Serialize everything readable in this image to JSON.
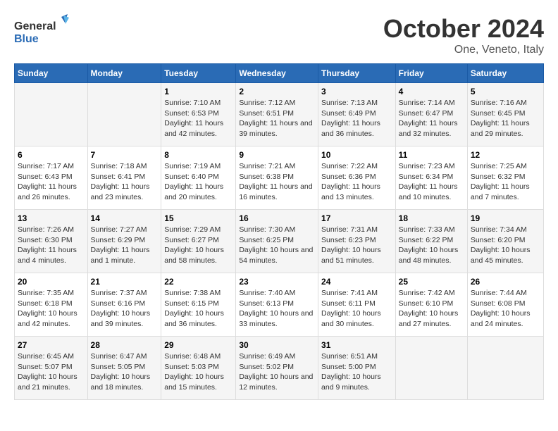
{
  "header": {
    "logo_line1": "General",
    "logo_line2": "Blue",
    "month": "October 2024",
    "location": "One, Veneto, Italy"
  },
  "days_of_week": [
    "Sunday",
    "Monday",
    "Tuesday",
    "Wednesday",
    "Thursday",
    "Friday",
    "Saturday"
  ],
  "weeks": [
    [
      {
        "day": "",
        "info": ""
      },
      {
        "day": "",
        "info": ""
      },
      {
        "day": "1",
        "info": "Sunrise: 7:10 AM\nSunset: 6:53 PM\nDaylight: 11 hours and 42 minutes."
      },
      {
        "day": "2",
        "info": "Sunrise: 7:12 AM\nSunset: 6:51 PM\nDaylight: 11 hours and 39 minutes."
      },
      {
        "day": "3",
        "info": "Sunrise: 7:13 AM\nSunset: 6:49 PM\nDaylight: 11 hours and 36 minutes."
      },
      {
        "day": "4",
        "info": "Sunrise: 7:14 AM\nSunset: 6:47 PM\nDaylight: 11 hours and 32 minutes."
      },
      {
        "day": "5",
        "info": "Sunrise: 7:16 AM\nSunset: 6:45 PM\nDaylight: 11 hours and 29 minutes."
      }
    ],
    [
      {
        "day": "6",
        "info": "Sunrise: 7:17 AM\nSunset: 6:43 PM\nDaylight: 11 hours and 26 minutes."
      },
      {
        "day": "7",
        "info": "Sunrise: 7:18 AM\nSunset: 6:41 PM\nDaylight: 11 hours and 23 minutes."
      },
      {
        "day": "8",
        "info": "Sunrise: 7:19 AM\nSunset: 6:40 PM\nDaylight: 11 hours and 20 minutes."
      },
      {
        "day": "9",
        "info": "Sunrise: 7:21 AM\nSunset: 6:38 PM\nDaylight: 11 hours and 16 minutes."
      },
      {
        "day": "10",
        "info": "Sunrise: 7:22 AM\nSunset: 6:36 PM\nDaylight: 11 hours and 13 minutes."
      },
      {
        "day": "11",
        "info": "Sunrise: 7:23 AM\nSunset: 6:34 PM\nDaylight: 11 hours and 10 minutes."
      },
      {
        "day": "12",
        "info": "Sunrise: 7:25 AM\nSunset: 6:32 PM\nDaylight: 11 hours and 7 minutes."
      }
    ],
    [
      {
        "day": "13",
        "info": "Sunrise: 7:26 AM\nSunset: 6:30 PM\nDaylight: 11 hours and 4 minutes."
      },
      {
        "day": "14",
        "info": "Sunrise: 7:27 AM\nSunset: 6:29 PM\nDaylight: 11 hours and 1 minute."
      },
      {
        "day": "15",
        "info": "Sunrise: 7:29 AM\nSunset: 6:27 PM\nDaylight: 10 hours and 58 minutes."
      },
      {
        "day": "16",
        "info": "Sunrise: 7:30 AM\nSunset: 6:25 PM\nDaylight: 10 hours and 54 minutes."
      },
      {
        "day": "17",
        "info": "Sunrise: 7:31 AM\nSunset: 6:23 PM\nDaylight: 10 hours and 51 minutes."
      },
      {
        "day": "18",
        "info": "Sunrise: 7:33 AM\nSunset: 6:22 PM\nDaylight: 10 hours and 48 minutes."
      },
      {
        "day": "19",
        "info": "Sunrise: 7:34 AM\nSunset: 6:20 PM\nDaylight: 10 hours and 45 minutes."
      }
    ],
    [
      {
        "day": "20",
        "info": "Sunrise: 7:35 AM\nSunset: 6:18 PM\nDaylight: 10 hours and 42 minutes."
      },
      {
        "day": "21",
        "info": "Sunrise: 7:37 AM\nSunset: 6:16 PM\nDaylight: 10 hours and 39 minutes."
      },
      {
        "day": "22",
        "info": "Sunrise: 7:38 AM\nSunset: 6:15 PM\nDaylight: 10 hours and 36 minutes."
      },
      {
        "day": "23",
        "info": "Sunrise: 7:40 AM\nSunset: 6:13 PM\nDaylight: 10 hours and 33 minutes."
      },
      {
        "day": "24",
        "info": "Sunrise: 7:41 AM\nSunset: 6:11 PM\nDaylight: 10 hours and 30 minutes."
      },
      {
        "day": "25",
        "info": "Sunrise: 7:42 AM\nSunset: 6:10 PM\nDaylight: 10 hours and 27 minutes."
      },
      {
        "day": "26",
        "info": "Sunrise: 7:44 AM\nSunset: 6:08 PM\nDaylight: 10 hours and 24 minutes."
      }
    ],
    [
      {
        "day": "27",
        "info": "Sunrise: 6:45 AM\nSunset: 5:07 PM\nDaylight: 10 hours and 21 minutes."
      },
      {
        "day": "28",
        "info": "Sunrise: 6:47 AM\nSunset: 5:05 PM\nDaylight: 10 hours and 18 minutes."
      },
      {
        "day": "29",
        "info": "Sunrise: 6:48 AM\nSunset: 5:03 PM\nDaylight: 10 hours and 15 minutes."
      },
      {
        "day": "30",
        "info": "Sunrise: 6:49 AM\nSunset: 5:02 PM\nDaylight: 10 hours and 12 minutes."
      },
      {
        "day": "31",
        "info": "Sunrise: 6:51 AM\nSunset: 5:00 PM\nDaylight: 10 hours and 9 minutes."
      },
      {
        "day": "",
        "info": ""
      },
      {
        "day": "",
        "info": ""
      }
    ]
  ]
}
